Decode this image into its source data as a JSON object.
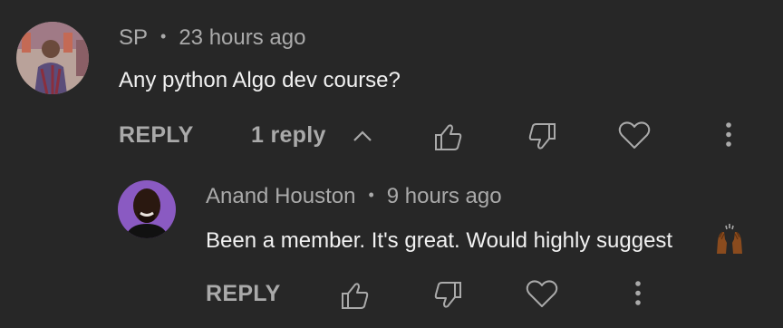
{
  "comment": {
    "author": "SP",
    "time": "23 hours ago",
    "text": "Any python Algo dev course?",
    "reply_label": "REPLY",
    "replies_label": "1 reply"
  },
  "reply": {
    "author": "Anand Houston",
    "time": "9 hours ago",
    "text": "Been a member. It's great. Would highly suggest",
    "emoji": "raising-hands",
    "reply_label": "REPLY"
  },
  "icons": {
    "like": "thumbs-up-icon",
    "dislike": "thumbs-down-icon",
    "heart": "heart-icon",
    "more": "more-vert-icon",
    "collapse": "chevron-up-icon"
  },
  "colors": {
    "background": "#272727",
    "text_primary": "#f1f1f1",
    "text_secondary": "#aaaaaa"
  }
}
